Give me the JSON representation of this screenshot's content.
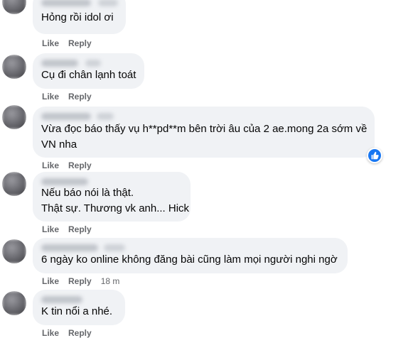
{
  "comments": [
    {
      "text": [
        "Hỏng rồi idol ơi"
      ],
      "actions": {
        "like": "Like",
        "reply": "Reply"
      }
    },
    {
      "text": [
        "Cụ đi chân lạnh toát"
      ],
      "actions": {
        "like": "Like",
        "reply": "Reply"
      }
    },
    {
      "text": [
        "Vừa đọc báo thấy vụ h**pd**m bên trời âu của 2 ae.mong 2a sớm về",
        "VN nha"
      ],
      "actions": {
        "like": "Like",
        "reply": "Reply"
      },
      "reaction_icon": "like-reaction-icon"
    },
    {
      "text": [
        "Nếu báo nói là thật.",
        "Thật sự. Thương vk anh... Hick"
      ],
      "actions": {
        "like": "Like",
        "reply": "Reply"
      }
    },
    {
      "text": [
        "6 ngày ko online không đăng bài cũng làm mọi người nghi ngờ"
      ],
      "actions": {
        "like": "Like",
        "reply": "Reply",
        "time": "18 m"
      }
    },
    {
      "text": [
        "K tin nổi a nhé."
      ],
      "actions": {
        "like": "Like",
        "reply": "Reply"
      }
    }
  ],
  "colors": {
    "bubble": "#f0f2f5",
    "text": "#050505",
    "meta": "#65676b",
    "like_blue": "#1877f2"
  }
}
